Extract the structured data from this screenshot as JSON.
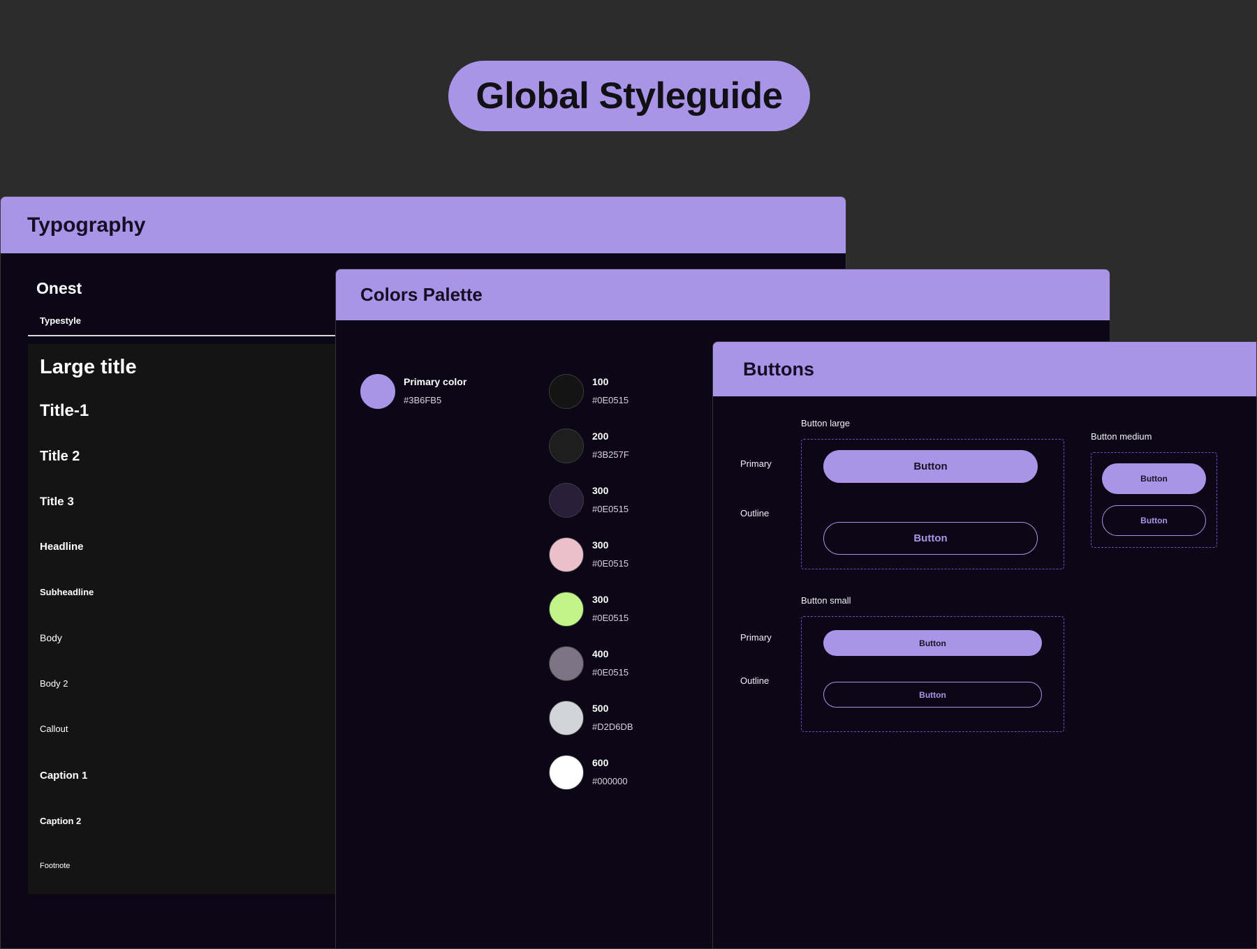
{
  "page_title": "Global Styleguide",
  "typography": {
    "title": "Typography",
    "font_name": "Onest",
    "typestyle_label": "Typestyle",
    "styles": [
      "Large title",
      "Title-1",
      "Title 2",
      "Title 3",
      "Headline",
      "Subheadline",
      "Body",
      "Body 2",
      "Callout",
      "Caption 1",
      "Caption 2",
      "Footnote"
    ]
  },
  "colors": {
    "title": "Colors Palette",
    "primary": {
      "name": "Primary color",
      "hex": "#3B6FB5",
      "swatch": "#a994e8"
    },
    "shades": [
      {
        "name": "100",
        "hex": "#0E0515",
        "swatch": "#141414"
      },
      {
        "name": "200",
        "hex": "#3B257F",
        "swatch": "#1e1e1e"
      },
      {
        "name": "300",
        "hex": "#0E0515",
        "swatch": "#2a1f3a"
      },
      {
        "name": "300",
        "hex": "#0E0515",
        "swatch": "#ecbfcc"
      },
      {
        "name": "300",
        "hex": "#0E0515",
        "swatch": "#c1f58a"
      },
      {
        "name": "400",
        "hex": "#0E0515",
        "swatch": "#7c7482"
      },
      {
        "name": "500",
        "hex": "#D2D6DB",
        "swatch": "#d2d4da"
      },
      {
        "name": "600",
        "hex": "#000000",
        "swatch": "#ffffff"
      }
    ]
  },
  "buttons": {
    "title": "Buttons",
    "large_label": "Button large",
    "medium_label": "Button medium",
    "small_label": "Button small",
    "primary_label": "Primary",
    "outline_label": "Outline",
    "button_text": "Button"
  },
  "theme": {
    "accent": "#a994e8",
    "card_bg": "#0c0716",
    "page_bg": "#2c2c2c",
    "dashed_border": "#6a50c4"
  }
}
